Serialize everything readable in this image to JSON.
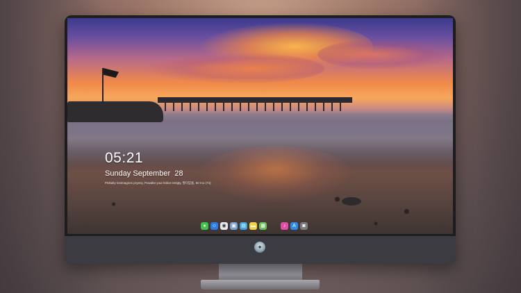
{
  "lockscreen": {
    "time": "05:21",
    "date": "Sunday September  28",
    "quote": "Pinkalty lostmagnes pryeny, Powalte your ktition terigty, 발더얻을, 60 mo (74)"
  },
  "dock": {
    "items": [
      {
        "name": "messages-icon",
        "glyph": "●",
        "color": "#3fc34a"
      },
      {
        "name": "finder-icon",
        "glyph": "☺",
        "color": "#2b7be5"
      },
      {
        "name": "safari-icon",
        "glyph": "◉",
        "color": "#e8e8ee"
      },
      {
        "name": "preview-icon",
        "glyph": "▣",
        "color": "#7b9fd1"
      },
      {
        "name": "clapper-icon",
        "glyph": "▤",
        "color": "#3fa7e0"
      },
      {
        "name": "notes-icon",
        "glyph": "▬",
        "color": "#f2d048"
      },
      {
        "name": "photos-icon",
        "glyph": "▦",
        "color": "#6cbf5a"
      },
      {
        "name": "music-icon",
        "glyph": "♪",
        "color": "#e04ea8"
      },
      {
        "name": "app-store-icon",
        "glyph": "A",
        "color": "#2e8ce8"
      },
      {
        "name": "camera-icon",
        "glyph": "◙",
        "color": "#7b7b82"
      }
    ]
  },
  "hardware": {
    "logo_glyph": "✦"
  }
}
